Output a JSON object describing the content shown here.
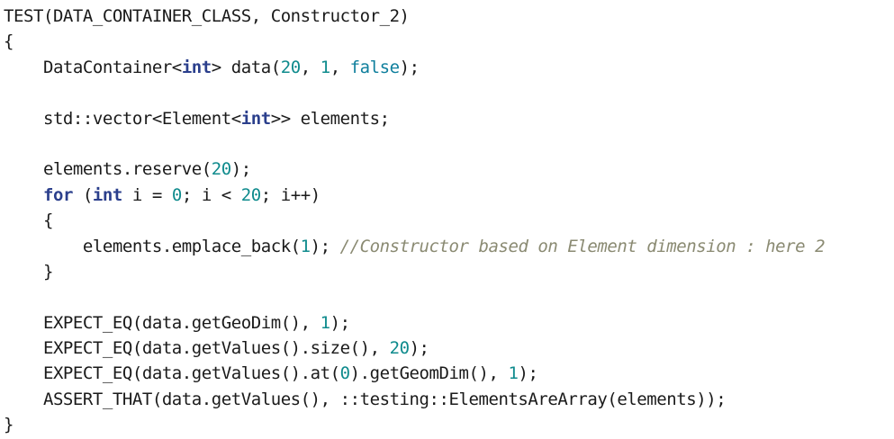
{
  "editor": {
    "colors": {
      "plain": "#1a1a1a",
      "keyword": "#2b3f8c",
      "number": "#0f8b8d",
      "literal": "#0f7f9d",
      "comment": "#8a8a72",
      "background": "#ffffff"
    },
    "lines": [
      [
        {
          "t": "plain",
          "v": "TEST(DATA_CONTAINER_CLASS, Constructor_2)"
        }
      ],
      [
        {
          "t": "plain",
          "v": "{"
        }
      ],
      [
        {
          "t": "plain",
          "v": "    DataContainer<"
        },
        {
          "t": "keyword",
          "v": "int"
        },
        {
          "t": "plain",
          "v": "> data("
        },
        {
          "t": "number",
          "v": "20"
        },
        {
          "t": "plain",
          "v": ", "
        },
        {
          "t": "number",
          "v": "1"
        },
        {
          "t": "plain",
          "v": ", "
        },
        {
          "t": "literal",
          "v": "false"
        },
        {
          "t": "plain",
          "v": ");"
        }
      ],
      [],
      [
        {
          "t": "plain",
          "v": "    std::vector<Element<"
        },
        {
          "t": "keyword",
          "v": "int"
        },
        {
          "t": "plain",
          "v": ">> elements;"
        }
      ],
      [],
      [
        {
          "t": "plain",
          "v": "    elements.reserve("
        },
        {
          "t": "number",
          "v": "20"
        },
        {
          "t": "plain",
          "v": ");"
        }
      ],
      [
        {
          "t": "plain",
          "v": "    "
        },
        {
          "t": "keyword",
          "v": "for"
        },
        {
          "t": "plain",
          "v": " ("
        },
        {
          "t": "keyword",
          "v": "int"
        },
        {
          "t": "plain",
          "v": " i = "
        },
        {
          "t": "number",
          "v": "0"
        },
        {
          "t": "plain",
          "v": "; i < "
        },
        {
          "t": "number",
          "v": "20"
        },
        {
          "t": "plain",
          "v": "; i++)"
        }
      ],
      [
        {
          "t": "plain",
          "v": "    {"
        }
      ],
      [
        {
          "t": "plain",
          "v": "        elements.emplace_back("
        },
        {
          "t": "number",
          "v": "1"
        },
        {
          "t": "plain",
          "v": "); "
        },
        {
          "t": "comment",
          "v": "//Constructor based on Element dimension : here 2"
        }
      ],
      [
        {
          "t": "plain",
          "v": "    }"
        }
      ],
      [],
      [
        {
          "t": "plain",
          "v": "    EXPECT_EQ(data.getGeoDim(), "
        },
        {
          "t": "number",
          "v": "1"
        },
        {
          "t": "plain",
          "v": ");"
        }
      ],
      [
        {
          "t": "plain",
          "v": "    EXPECT_EQ(data.getValues().size(), "
        },
        {
          "t": "number",
          "v": "20"
        },
        {
          "t": "plain",
          "v": ");"
        }
      ],
      [
        {
          "t": "plain",
          "v": "    EXPECT_EQ(data.getValues().at("
        },
        {
          "t": "number",
          "v": "0"
        },
        {
          "t": "plain",
          "v": ").getGeomDim(), "
        },
        {
          "t": "number",
          "v": "1"
        },
        {
          "t": "plain",
          "v": ");"
        }
      ],
      [
        {
          "t": "plain",
          "v": "    ASSERT_THAT(data.getValues(), ::testing::ElementsAreArray(elements));"
        }
      ],
      [
        {
          "t": "plain",
          "v": "}"
        }
      ]
    ]
  }
}
